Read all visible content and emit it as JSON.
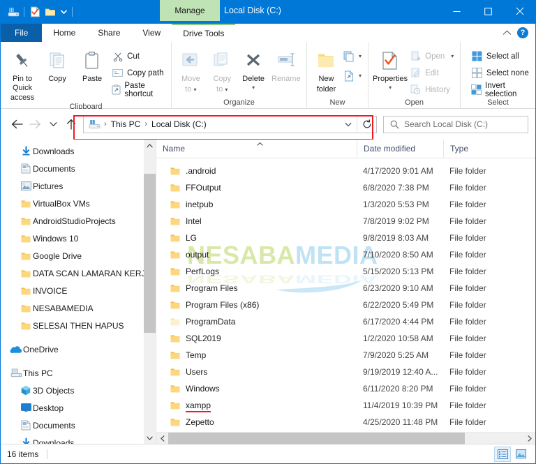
{
  "window": {
    "title": "Local Disk (C:)",
    "contextual_tab": "Manage",
    "minimize": "minimize-icon",
    "maximize": "maximize-icon",
    "close": "close-icon"
  },
  "quick_access_toolbar": {
    "items": [
      {
        "name": "drive-icon",
        "label": ""
      },
      {
        "name": "properties-icon",
        "label": ""
      },
      {
        "name": "new-folder-icon",
        "label": ""
      },
      {
        "name": "customize-dropdown-icon",
        "label": ""
      }
    ]
  },
  "tabs": [
    {
      "id": "file",
      "label": "File"
    },
    {
      "id": "home",
      "label": "Home"
    },
    {
      "id": "share",
      "label": "Share"
    },
    {
      "id": "view",
      "label": "View"
    },
    {
      "id": "drive-tools",
      "label": "Drive Tools"
    }
  ],
  "ribbon_help": "?",
  "ribbon": {
    "groups": [
      {
        "label": "Clipboard",
        "big": [
          {
            "label_1": "Pin to Quick",
            "label_2": "access",
            "icon": "pin-icon",
            "dim": false
          },
          {
            "label_1": "Copy",
            "label_2": "",
            "icon": "copy-icon",
            "dim": false
          },
          {
            "label_1": "Paste",
            "label_2": "",
            "icon": "paste-icon",
            "dim": false
          }
        ],
        "small": [
          {
            "label": "Cut",
            "icon": "scissors-icon",
            "dim": false
          },
          {
            "label": "Copy path",
            "icon": "copy-path-icon",
            "dim": false
          },
          {
            "label": "Paste shortcut",
            "icon": "paste-shortcut-icon",
            "dim": false
          }
        ]
      },
      {
        "label": "Organize",
        "big": [
          {
            "label_1": "Move",
            "label_2": "to",
            "icon": "move-to-icon",
            "dim": true
          },
          {
            "label_1": "Copy",
            "label_2": "to",
            "icon": "copy-to-icon",
            "dim": true
          },
          {
            "label_1": "Delete",
            "label_2": "",
            "icon": "delete-icon",
            "dim": false
          },
          {
            "label_1": "Rename",
            "label_2": "",
            "icon": "rename-icon",
            "dim": true
          }
        ],
        "small": []
      },
      {
        "label": "New",
        "big": [
          {
            "label_1": "New",
            "label_2": "folder",
            "icon": "new-folder-icon",
            "dim": false
          }
        ],
        "small": [
          {
            "label": "",
            "icon": "new-item-icon",
            "dim": false
          },
          {
            "label": "",
            "icon": "easy-access-icon",
            "dim": false
          }
        ]
      },
      {
        "label": "Open",
        "big": [
          {
            "label_1": "Properties",
            "label_2": "",
            "icon": "properties-icon",
            "dim": false
          }
        ],
        "small": [
          {
            "label": "Open",
            "icon": "open-icon",
            "dim": true
          },
          {
            "label": "Edit",
            "icon": "edit-icon",
            "dim": true
          },
          {
            "label": "History",
            "icon": "history-icon",
            "dim": true
          }
        ]
      },
      {
        "label": "Select",
        "big": [],
        "small": [
          {
            "label": "Select all",
            "icon": "select-all-icon",
            "dim": false
          },
          {
            "label": "Select none",
            "icon": "select-none-icon",
            "dim": false
          },
          {
            "label": "Invert selection",
            "icon": "invert-selection-icon",
            "dim": false
          }
        ]
      }
    ]
  },
  "addressbar": {
    "back": "back-arrow-icon",
    "forward": "forward-arrow-icon",
    "recent": "recent-locations-icon",
    "up": "up-arrow-icon",
    "computer_icon": "this-pc-icon",
    "crumbs": [
      "This PC",
      "Local Disk (C:)"
    ],
    "separator": "›",
    "dropdown": "chevron-down-icon",
    "refresh": "refresh-icon",
    "highlight_color": "#ee1c24"
  },
  "search": {
    "icon": "search-icon",
    "placeholder": "Search Local Disk (C:)",
    "value": ""
  },
  "navpane": {
    "items": [
      {
        "label": "Downloads",
        "icon": "downloads-icon",
        "pinned": true,
        "indent": 1
      },
      {
        "label": "Documents",
        "icon": "documents-icon",
        "pinned": true,
        "indent": 1
      },
      {
        "label": "Pictures",
        "icon": "pictures-icon",
        "pinned": true,
        "indent": 1
      },
      {
        "label": "VirtualBox VMs",
        "icon": "folder-icon",
        "pinned": true,
        "indent": 1
      },
      {
        "label": "AndroidStudioProjects",
        "icon": "folder-icon",
        "pinned": true,
        "indent": 1
      },
      {
        "label": "Windows 10",
        "icon": "folder-icon",
        "pinned": true,
        "indent": 1
      },
      {
        "label": "Google Drive",
        "icon": "folder-icon",
        "pinned": true,
        "indent": 1
      },
      {
        "label": "DATA SCAN LAMARAN KERJA",
        "icon": "folder-icon",
        "pinned": false,
        "indent": 1
      },
      {
        "label": "INVOICE",
        "icon": "folder-icon",
        "pinned": false,
        "indent": 1
      },
      {
        "label": "NESABAMEDIA",
        "icon": "folder-icon",
        "pinned": false,
        "indent": 1
      },
      {
        "label": "SELESAI THEN HAPUS",
        "icon": "folder-icon",
        "pinned": false,
        "indent": 1
      },
      {
        "label": "",
        "icon": "gap",
        "pinned": false,
        "indent": 0
      },
      {
        "label": "OneDrive",
        "icon": "onedrive-icon",
        "pinned": false,
        "indent": 2
      },
      {
        "label": "",
        "icon": "gap",
        "pinned": false,
        "indent": 0
      },
      {
        "label": "This PC",
        "icon": "this-pc-icon",
        "pinned": false,
        "indent": 2
      },
      {
        "label": "3D Objects",
        "icon": "3d-objects-icon",
        "pinned": false,
        "indent": 1
      },
      {
        "label": "Desktop",
        "icon": "desktop-icon",
        "pinned": false,
        "indent": 1
      },
      {
        "label": "Documents",
        "icon": "documents-icon",
        "pinned": false,
        "indent": 1
      },
      {
        "label": "Downloads",
        "icon": "downloads-icon",
        "pinned": false,
        "indent": 1
      }
    ],
    "scroll_up": "scroll-up-arrow",
    "scroll_down": "scroll-down-arrow"
  },
  "filelist": {
    "columns": [
      {
        "key": "name",
        "label": "Name",
        "sorted": "asc"
      },
      {
        "key": "date",
        "label": "Date modified",
        "sorted": ""
      },
      {
        "key": "type",
        "label": "Type",
        "sorted": ""
      }
    ],
    "rows": [
      {
        "name": ".android",
        "date": "4/17/2020 9:01 AM",
        "type": "File folder",
        "icon": "folder-icon",
        "dim": false,
        "underline": false
      },
      {
        "name": "FFOutput",
        "date": "6/8/2020 7:38 PM",
        "type": "File folder",
        "icon": "folder-icon",
        "dim": false,
        "underline": false
      },
      {
        "name": "inetpub",
        "date": "1/3/2020 5:53 PM",
        "type": "File folder",
        "icon": "folder-icon",
        "dim": false,
        "underline": false
      },
      {
        "name": "Intel",
        "date": "7/8/2019 9:02 PM",
        "type": "File folder",
        "icon": "folder-icon",
        "dim": false,
        "underline": false
      },
      {
        "name": "LG",
        "date": "9/8/2019 8:03 AM",
        "type": "File folder",
        "icon": "folder-icon",
        "dim": false,
        "underline": false
      },
      {
        "name": "output",
        "date": "7/10/2020 8:50 AM",
        "type": "File folder",
        "icon": "folder-icon",
        "dim": false,
        "underline": false
      },
      {
        "name": "PerfLogs",
        "date": "5/15/2020 5:13 PM",
        "type": "File folder",
        "icon": "folder-icon",
        "dim": false,
        "underline": false
      },
      {
        "name": "Program Files",
        "date": "6/23/2020 9:10 AM",
        "type": "File folder",
        "icon": "folder-icon",
        "dim": false,
        "underline": false
      },
      {
        "name": "Program Files (x86)",
        "date": "6/22/2020 5:49 PM",
        "type": "File folder",
        "icon": "folder-icon",
        "dim": false,
        "underline": false
      },
      {
        "name": "ProgramData",
        "date": "6/17/2020 4:44 PM",
        "type": "File folder",
        "icon": "folder-icon",
        "dim": true,
        "underline": false
      },
      {
        "name": "SQL2019",
        "date": "1/2/2020 10:58 AM",
        "type": "File folder",
        "icon": "folder-icon",
        "dim": false,
        "underline": false
      },
      {
        "name": "Temp",
        "date": "7/9/2020 5:25 AM",
        "type": "File folder",
        "icon": "folder-icon",
        "dim": false,
        "underline": false
      },
      {
        "name": "Users",
        "date": "9/19/2019 12:40 A...",
        "type": "File folder",
        "icon": "folder-icon",
        "dim": false,
        "underline": false
      },
      {
        "name": "Windows",
        "date": "6/11/2020 8:20 PM",
        "type": "File folder",
        "icon": "folder-icon",
        "dim": false,
        "underline": false
      },
      {
        "name": "xampp",
        "date": "11/4/2019 10:39 PM",
        "type": "File folder",
        "icon": "folder-icon",
        "dim": false,
        "underline": true
      },
      {
        "name": "Zepetto",
        "date": "4/25/2020 11:48 PM",
        "type": "File folder",
        "icon": "folder-icon",
        "dim": false,
        "underline": false
      }
    ]
  },
  "watermark": {
    "part_1": "NESABA",
    "part_2": "MEDIA",
    "color_1": "#d9e8a8",
    "color_2": "#bfe3f5"
  },
  "statusbar": {
    "item_count": "16 items",
    "details_view": "details-view-icon",
    "large_icons_view": "large-icons-view-icon"
  }
}
